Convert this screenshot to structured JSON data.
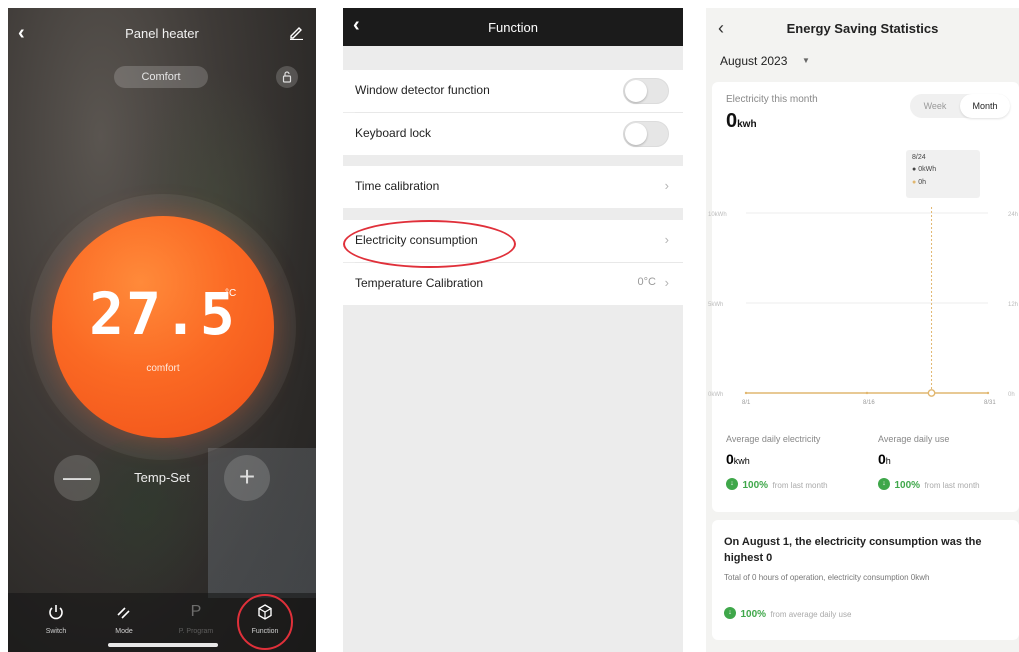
{
  "heater_panel": {
    "title": "Panel heater",
    "mode_pill": "Comfort",
    "temperature": "27.5",
    "temperature_unit": "°C",
    "temperature_mode": "comfort",
    "minus_label": "—",
    "plus_label": "+",
    "tempset_label": "Temp-Set",
    "nav": [
      {
        "label": "Switch",
        "icon": "power-icon"
      },
      {
        "label": "Mode",
        "icon": "mode-icon"
      },
      {
        "label": "P. Program",
        "icon": "program-icon"
      },
      {
        "label": "Function",
        "icon": "function-cube-icon"
      }
    ],
    "accent_color": "#fb6a24"
  },
  "function_panel": {
    "title": "Function",
    "rows": [
      {
        "label": "Window detector function",
        "type": "toggle",
        "on": false
      },
      {
        "label": "Keyboard lock",
        "type": "toggle",
        "on": false
      },
      {
        "label": "Time calibration",
        "type": "link"
      },
      {
        "label": "Electricity consumption",
        "type": "link"
      },
      {
        "label": "Temperature Calibration",
        "type": "link",
        "value": "0°C"
      }
    ],
    "highlight_color": "#e0303a"
  },
  "stats_panel": {
    "title": "Energy Saving Statistics",
    "month": "August 2023",
    "this_month_label": "Electricity this month",
    "this_month_value": "0",
    "this_month_unit": "kwh",
    "segment": {
      "options": [
        "Week",
        "Month"
      ],
      "selected": "Month"
    },
    "tooltip": {
      "date": "8/24",
      "kwh": "0kWh",
      "hours": "0h"
    },
    "chart_data": {
      "type": "line",
      "x": [
        "8/1",
        "8/16",
        "8/31"
      ],
      "y_left_ticks": [
        "0kWh",
        "5kWh",
        "10kWh"
      ],
      "y_right_ticks": [
        "0h",
        "12h",
        "24h"
      ],
      "series": [
        {
          "values": [
            0,
            0,
            0
          ]
        }
      ],
      "ylim": [
        0,
        10
      ],
      "ylabel": ""
    },
    "avg_electricity_label": "Average daily electricity",
    "avg_electricity_value": "0",
    "avg_electricity_unit": "kwh",
    "avg_use_label": "Average daily use",
    "avg_use_value": "0",
    "avg_use_unit": "h",
    "pct_1": "100%",
    "pct_1_sub": "from last month",
    "pct_2": "100%",
    "pct_2_sub": "from last month",
    "summary_title": "On August 1, the electricity consumption was the highest 0",
    "summary_line": "Total of 0 hours of operation, electricity consumption 0kwh",
    "pct_3": "100%",
    "pct_3_sub": "from average daily use",
    "line_color": "#e1b770",
    "positive_color": "#3fa74a"
  }
}
